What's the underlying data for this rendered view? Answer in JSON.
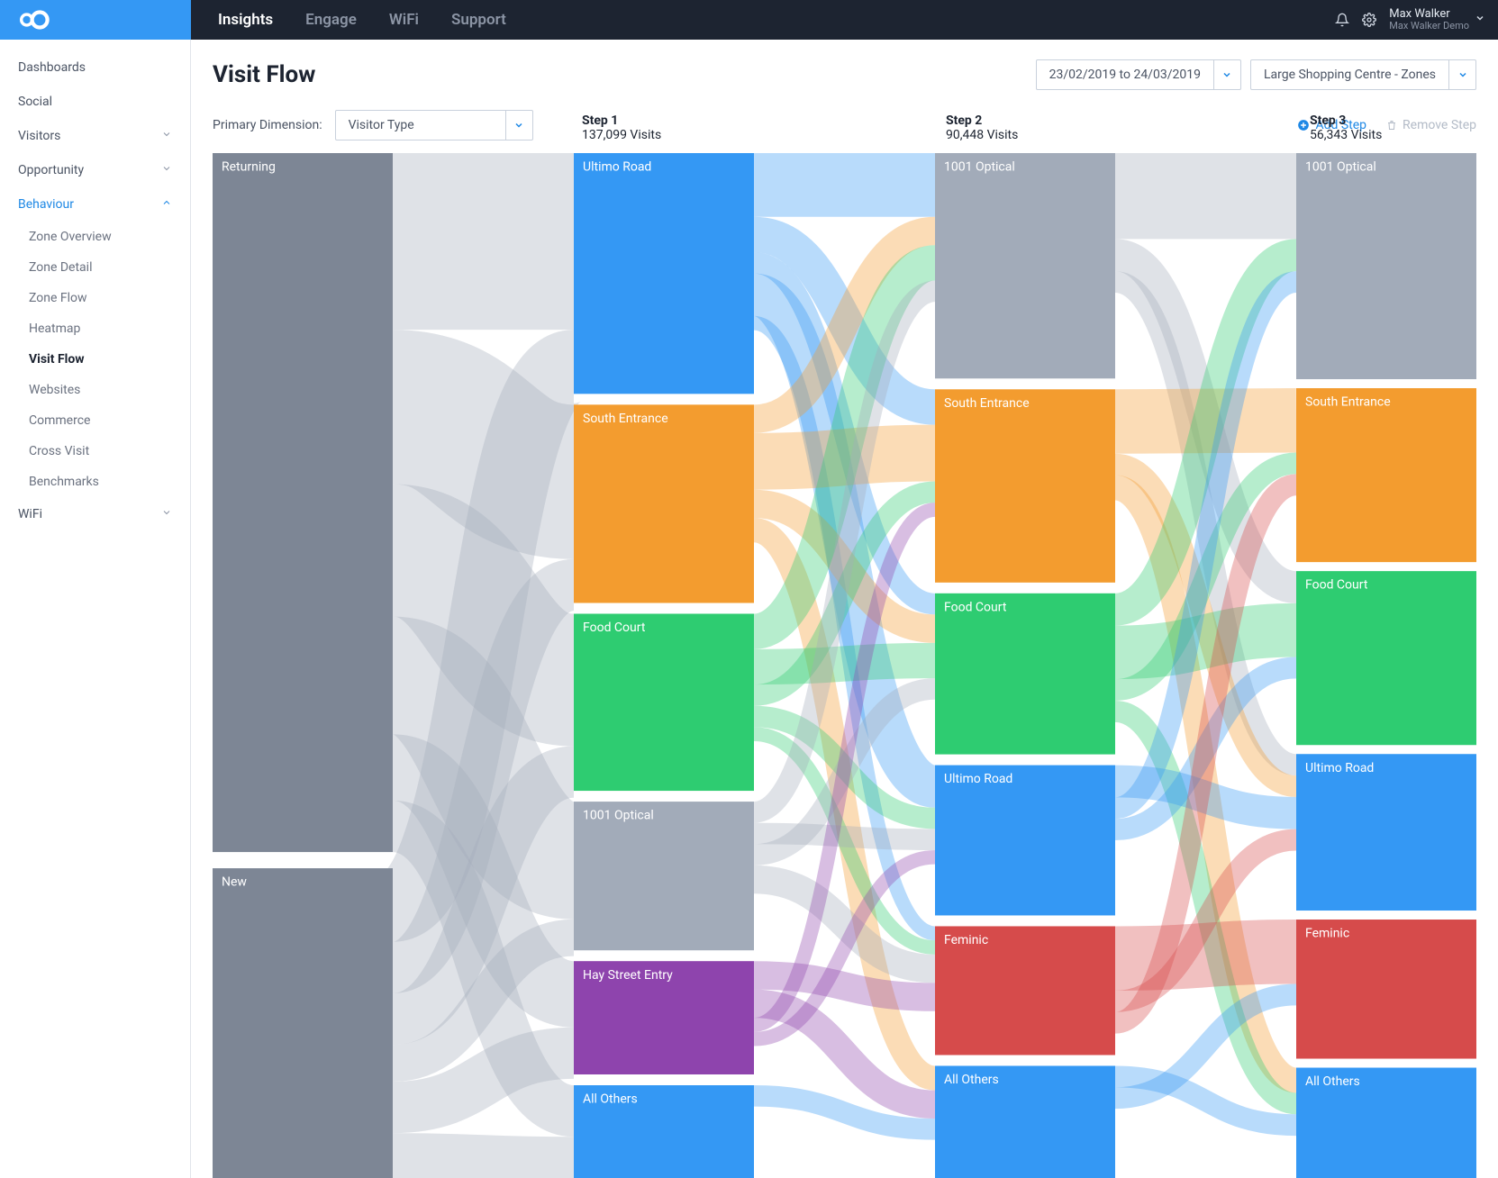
{
  "nav": {
    "tabs": [
      "Insights",
      "Engage",
      "WiFi",
      "Support"
    ],
    "active_tab": 0
  },
  "user": {
    "name": "Max Walker",
    "sub": "Max Walker Demo"
  },
  "sidebar": [
    {
      "label": "Dashboards",
      "expandable": false
    },
    {
      "label": "Social",
      "expandable": false
    },
    {
      "label": "Visitors",
      "expandable": true
    },
    {
      "label": "Opportunity",
      "expandable": true
    },
    {
      "label": "Behaviour",
      "expandable": true,
      "active": true,
      "children": [
        {
          "label": "Zone Overview"
        },
        {
          "label": "Zone Detail"
        },
        {
          "label": "Zone Flow"
        },
        {
          "label": "Heatmap"
        },
        {
          "label": "Visit Flow",
          "active": true
        },
        {
          "label": "Websites"
        },
        {
          "label": "Commerce"
        },
        {
          "label": "Cross Visit"
        },
        {
          "label": "Benchmarks"
        }
      ]
    },
    {
      "label": "WiFi",
      "expandable": true
    }
  ],
  "page": {
    "title": "Visit Flow",
    "date_range": "23/02/2019 to 24/03/2019",
    "location": "Large Shopping Centre - Zones",
    "primary_dimension_label": "Primary Dimension:",
    "primary_dimension_value": "Visitor Type",
    "add_step": "Add Step",
    "remove_step": "Remove Step"
  },
  "chart_data": {
    "type": "sankey",
    "steps": [
      {
        "title": "Step 1",
        "visits_label": "137,099 Visits",
        "visits": 137099
      },
      {
        "title": "Step 2",
        "visits_label": "90,448 Visits",
        "visits": 90448
      },
      {
        "title": "Step 3",
        "visits_label": "56,343 Visits",
        "visits": 56343
      }
    ],
    "columns": [
      {
        "id": "source",
        "nodes": [
          {
            "id": "returning",
            "label": "Returning",
            "value": 95000,
            "color": "#7d8695"
          },
          {
            "id": "new",
            "label": "New",
            "value": 42099,
            "color": "#7d8695"
          }
        ]
      },
      {
        "id": "step1",
        "nodes": [
          {
            "id": "s1_ultimo",
            "label": "Ultimo Road",
            "value": 34000,
            "color": "#3498f4"
          },
          {
            "id": "s1_south",
            "label": "South Entrance",
            "value": 28000,
            "color": "#f39c2f"
          },
          {
            "id": "s1_food",
            "label": "Food Court",
            "value": 25000,
            "color": "#2ecc71"
          },
          {
            "id": "s1_1001",
            "label": "1001 Optical",
            "value": 21000,
            "color": "#a2abb9"
          },
          {
            "id": "s1_hay",
            "label": "Hay Street Entry",
            "value": 16000,
            "color": "#8e44ad"
          },
          {
            "id": "s1_other",
            "label": "All Others",
            "value": 13099,
            "color": "#3498f4"
          }
        ]
      },
      {
        "id": "step2",
        "nodes": [
          {
            "id": "s2_1001",
            "label": "1001 Optical",
            "value": 21000,
            "color": "#a2abb9"
          },
          {
            "id": "s2_south",
            "label": "South Entrance",
            "value": 18000,
            "color": "#f39c2f"
          },
          {
            "id": "s2_food",
            "label": "Food Court",
            "value": 15000,
            "color": "#2ecc71"
          },
          {
            "id": "s2_ultimo",
            "label": "Ultimo Road",
            "value": 14000,
            "color": "#3498f4"
          },
          {
            "id": "s2_feminic",
            "label": "Feminic",
            "value": 12000,
            "color": "#d64b4b"
          },
          {
            "id": "s2_other",
            "label": "All Others",
            "value": 10448,
            "color": "#3498f4"
          }
        ]
      },
      {
        "id": "step3",
        "nodes": [
          {
            "id": "s3_1001",
            "label": "1001 Optical",
            "value": 13000,
            "color": "#a2abb9"
          },
          {
            "id": "s3_south",
            "label": "South Entrance",
            "value": 10000,
            "color": "#f39c2f"
          },
          {
            "id": "s3_food",
            "label": "Food Court",
            "value": 10000,
            "color": "#2ecc71"
          },
          {
            "id": "s3_ultimo",
            "label": "Ultimo Road",
            "value": 9000,
            "color": "#3498f4"
          },
          {
            "id": "s3_feminic",
            "label": "Feminic",
            "value": 8000,
            "color": "#d64b4b"
          },
          {
            "id": "s3_other",
            "label": "All Others",
            "value": 6343,
            "color": "#3498f4"
          }
        ]
      }
    ],
    "links": [
      {
        "from": "returning",
        "to": "s1_ultimo",
        "value": 24000,
        "color": "#a2abb9"
      },
      {
        "from": "returning",
        "to": "s1_south",
        "value": 21000,
        "color": "#a2abb9"
      },
      {
        "from": "returning",
        "to": "s1_food",
        "value": 18000,
        "color": "#a2abb9"
      },
      {
        "from": "returning",
        "to": "s1_1001",
        "value": 16000,
        "color": "#a2abb9"
      },
      {
        "from": "returning",
        "to": "s1_hay",
        "value": 9000,
        "color": "#a2abb9"
      },
      {
        "from": "returning",
        "to": "s1_other",
        "value": 7000,
        "color": "#a2abb9"
      },
      {
        "from": "new",
        "to": "s1_ultimo",
        "value": 10000,
        "color": "#a2abb9"
      },
      {
        "from": "new",
        "to": "s1_south",
        "value": 7000,
        "color": "#a2abb9"
      },
      {
        "from": "new",
        "to": "s1_food",
        "value": 7000,
        "color": "#a2abb9"
      },
      {
        "from": "new",
        "to": "s1_1001",
        "value": 5000,
        "color": "#a2abb9"
      },
      {
        "from": "new",
        "to": "s1_hay",
        "value": 7000,
        "color": "#a2abb9"
      },
      {
        "from": "new",
        "to": "s1_other",
        "value": 6099,
        "color": "#a2abb9"
      },
      {
        "from": "s1_ultimo",
        "to": "s2_1001",
        "value": 9000,
        "color": "#3498f4"
      },
      {
        "from": "s1_ultimo",
        "to": "s2_south",
        "value": 5000,
        "color": "#3498f4"
      },
      {
        "from": "s1_ultimo",
        "to": "s2_food",
        "value": 3000,
        "color": "#3498f4"
      },
      {
        "from": "s1_ultimo",
        "to": "s2_ultimo",
        "value": 6000,
        "color": "#3498f4"
      },
      {
        "from": "s1_ultimo",
        "to": "s2_feminic",
        "value": 2000,
        "color": "#3498f4"
      },
      {
        "from": "s1_south",
        "to": "s2_1001",
        "value": 4000,
        "color": "#f39c2f"
      },
      {
        "from": "s1_south",
        "to": "s2_south",
        "value": 8000,
        "color": "#f39c2f"
      },
      {
        "from": "s1_south",
        "to": "s2_food",
        "value": 4000,
        "color": "#f39c2f"
      },
      {
        "from": "s1_south",
        "to": "s2_other",
        "value": 3448,
        "color": "#f39c2f"
      },
      {
        "from": "s1_food",
        "to": "s2_1001",
        "value": 5000,
        "color": "#2ecc71"
      },
      {
        "from": "s1_food",
        "to": "s2_food",
        "value": 5000,
        "color": "#2ecc71"
      },
      {
        "from": "s1_food",
        "to": "s2_south",
        "value": 3000,
        "color": "#2ecc71"
      },
      {
        "from": "s1_food",
        "to": "s2_ultimo",
        "value": 3000,
        "color": "#2ecc71"
      },
      {
        "from": "s1_food",
        "to": "s2_feminic",
        "value": 2000,
        "color": "#2ecc71"
      },
      {
        "from": "s1_1001",
        "to": "s2_1001",
        "value": 3000,
        "color": "#a2abb9"
      },
      {
        "from": "s1_1001",
        "to": "s2_ultimo",
        "value": 3000,
        "color": "#a2abb9"
      },
      {
        "from": "s1_1001",
        "to": "s2_food",
        "value": 3000,
        "color": "#a2abb9"
      },
      {
        "from": "s1_1001",
        "to": "s2_feminic",
        "value": 4000,
        "color": "#a2abb9"
      },
      {
        "from": "s1_hay",
        "to": "s2_feminic",
        "value": 4000,
        "color": "#8e44ad"
      },
      {
        "from": "s1_hay",
        "to": "s2_other",
        "value": 4000,
        "color": "#8e44ad"
      },
      {
        "from": "s1_hay",
        "to": "s2_south",
        "value": 2000,
        "color": "#8e44ad"
      },
      {
        "from": "s1_hay",
        "to": "s2_ultimo",
        "value": 2000,
        "color": "#8e44ad"
      },
      {
        "from": "s1_other",
        "to": "s2_other",
        "value": 3000,
        "color": "#3498f4"
      },
      {
        "from": "s2_1001",
        "to": "s3_1001",
        "value": 8000,
        "color": "#a2abb9"
      },
      {
        "from": "s2_1001",
        "to": "s3_food",
        "value": 3000,
        "color": "#a2abb9"
      },
      {
        "from": "s2_1001",
        "to": "s3_ultimo",
        "value": 2000,
        "color": "#a2abb9"
      },
      {
        "from": "s2_south",
        "to": "s3_south",
        "value": 6000,
        "color": "#f39c2f"
      },
      {
        "from": "s2_south",
        "to": "s3_ultimo",
        "value": 2000,
        "color": "#f39c2f"
      },
      {
        "from": "s2_south",
        "to": "s3_other",
        "value": 2343,
        "color": "#f39c2f"
      },
      {
        "from": "s2_food",
        "to": "s3_1001",
        "value": 3000,
        "color": "#2ecc71"
      },
      {
        "from": "s2_food",
        "to": "s3_food",
        "value": 5000,
        "color": "#2ecc71"
      },
      {
        "from": "s2_food",
        "to": "s3_south",
        "value": 2000,
        "color": "#2ecc71"
      },
      {
        "from": "s2_food",
        "to": "s3_other",
        "value": 2000,
        "color": "#2ecc71"
      },
      {
        "from": "s2_ultimo",
        "to": "s3_ultimo",
        "value": 3000,
        "color": "#3498f4"
      },
      {
        "from": "s2_ultimo",
        "to": "s3_1001",
        "value": 2000,
        "color": "#3498f4"
      },
      {
        "from": "s2_ultimo",
        "to": "s3_food",
        "value": 2000,
        "color": "#3498f4"
      },
      {
        "from": "s2_feminic",
        "to": "s3_feminic",
        "value": 6000,
        "color": "#d64b4b"
      },
      {
        "from": "s2_feminic",
        "to": "s3_ultimo",
        "value": 2000,
        "color": "#d64b4b"
      },
      {
        "from": "s2_feminic",
        "to": "s3_south",
        "value": 2000,
        "color": "#d64b4b"
      },
      {
        "from": "s2_other",
        "to": "s3_other",
        "value": 2000,
        "color": "#3498f4"
      },
      {
        "from": "s2_other",
        "to": "s3_feminic",
        "value": 2000,
        "color": "#3498f4"
      }
    ]
  }
}
